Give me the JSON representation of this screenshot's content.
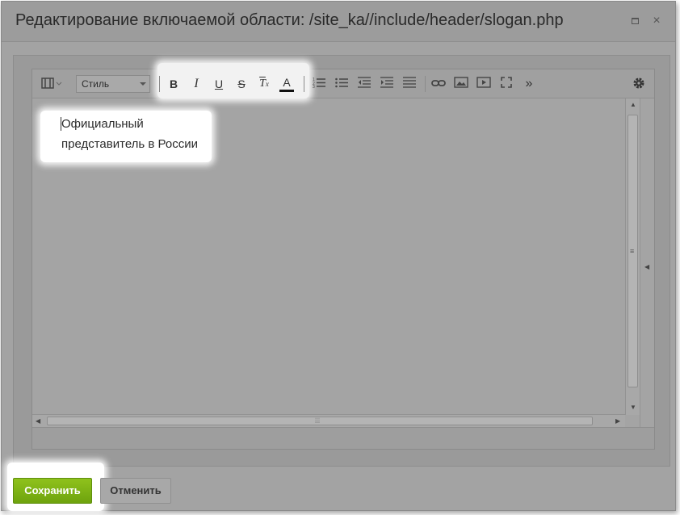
{
  "dialog": {
    "title": "Редактирование включаемой области: /site_ka//include/header/slogan.php",
    "maximize_icon": "maximize-icon",
    "close_icon": "close-icon",
    "close_glyph": "×"
  },
  "toolbar": {
    "style_select": {
      "value": "Стиль"
    },
    "bold": "B",
    "italic": "I",
    "underline": "U",
    "strike": "S",
    "clear_format": "T",
    "clear_format_sub": "x",
    "font_color": "A",
    "more": "»",
    "icons": [
      "view-mode-icon",
      "bold-icon",
      "italic-icon",
      "underline-icon",
      "strikethrough-icon",
      "remove-format-icon",
      "font-color-icon",
      "ordered-list-icon",
      "unordered-list-icon",
      "outdent-icon",
      "indent-icon",
      "align-icon",
      "link-icon",
      "image-icon",
      "video-icon",
      "fullscreen-icon",
      "more-icon",
      "settings-icon"
    ]
  },
  "editor": {
    "lines": [
      "Официальный",
      "представитель в России"
    ]
  },
  "footer": {
    "save_label": "Сохранить",
    "cancel_label": "Отменить"
  },
  "colors": {
    "save_button": "#7fb316",
    "overlay": "#a3a3a3"
  }
}
